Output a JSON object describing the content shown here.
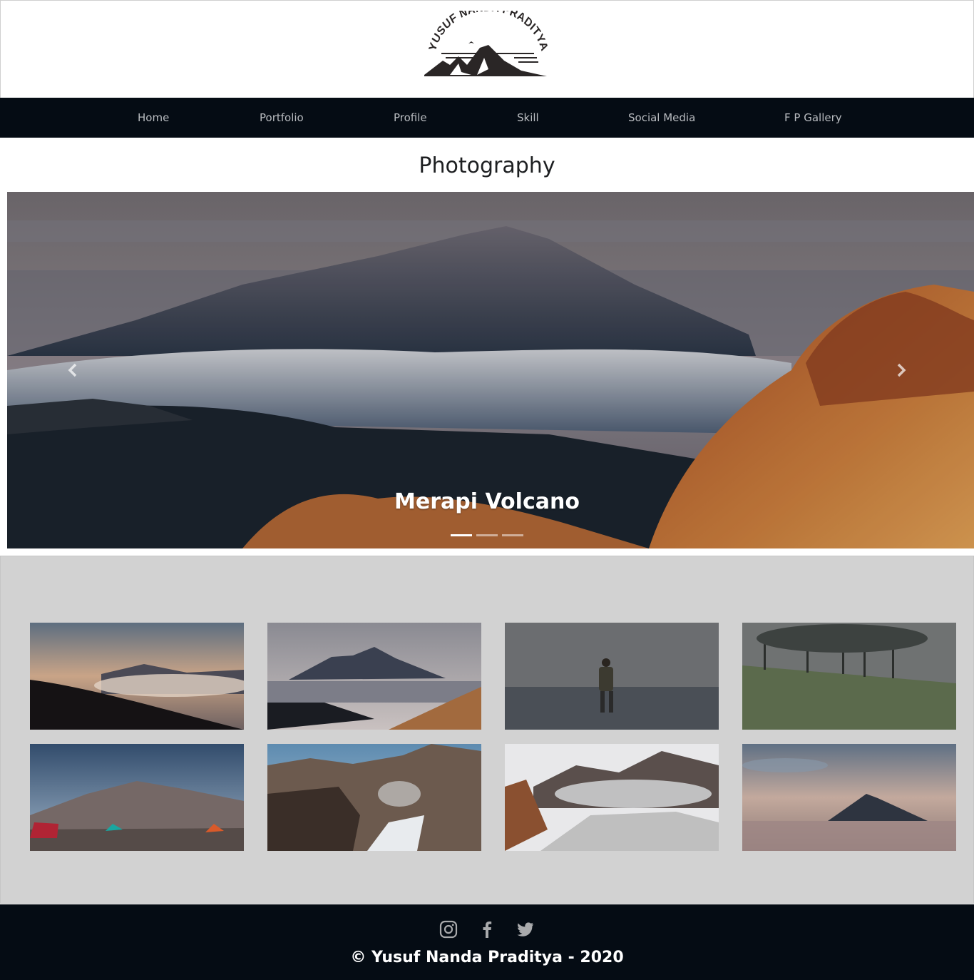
{
  "brand": {
    "logo_text": "YUSUF NANDA PRADITYA"
  },
  "nav": {
    "items": [
      {
        "label": "Home"
      },
      {
        "label": "Portfolio"
      },
      {
        "label": "Profile"
      },
      {
        "label": "Skill"
      },
      {
        "label": "Social Media"
      },
      {
        "label": "F P Gallery"
      }
    ]
  },
  "main": {
    "title": "Photography"
  },
  "carousel": {
    "caption": "Merapi Volcano",
    "slide_count": 3,
    "active_index": 0,
    "prev_icon": "chevron-left-icon",
    "next_icon": "chevron-right-icon"
  },
  "gallery": {
    "background": "#d2d2d2",
    "photo_count": 8
  },
  "footer": {
    "social": [
      {
        "icon": "instagram-icon"
      },
      {
        "icon": "facebook-icon"
      },
      {
        "icon": "twitter-icon"
      }
    ],
    "copyright": "© Yusuf Nanda Praditya - 2020"
  },
  "colors": {
    "nav_bg": "#050c14",
    "nav_text": "#b9bcc0",
    "footer_bg": "#050c14"
  }
}
